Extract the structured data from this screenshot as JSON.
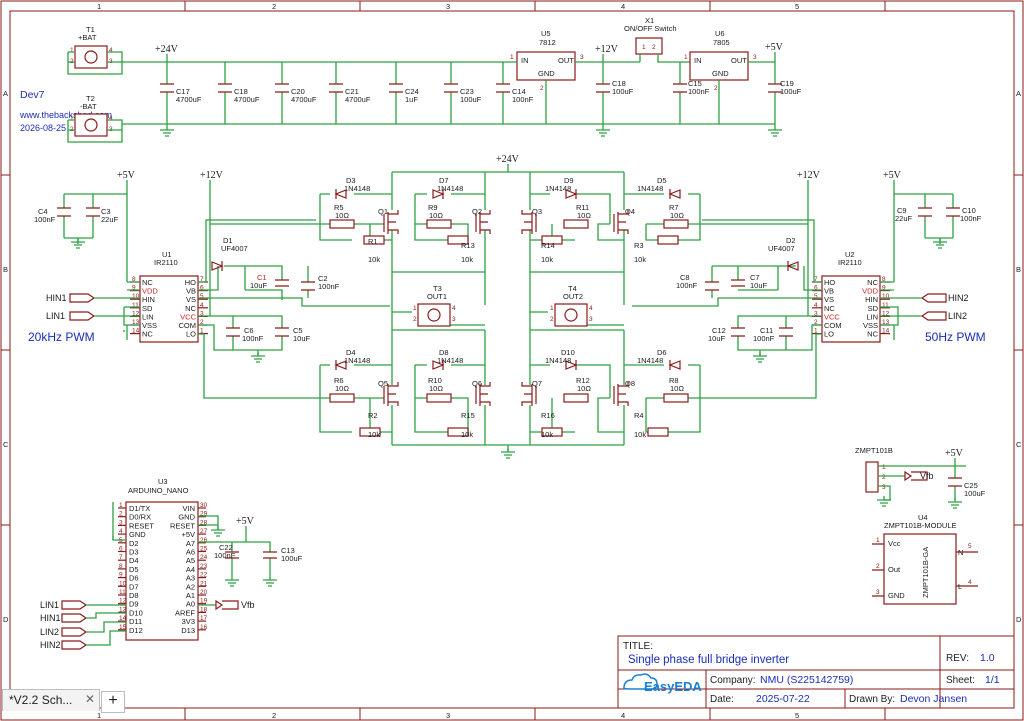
{
  "sheet": {
    "col_labels": [
      "1",
      "2",
      "3",
      "4",
      "5"
    ],
    "row_labels": [
      "A",
      "B",
      "C",
      "D"
    ]
  },
  "notes": {
    "dev": "Dev7",
    "site": "www.thebackshed.com",
    "date": "2026-08-25",
    "pwm_left": "20kHz PWM",
    "pwm_right": "50Hz PWM"
  },
  "rails": {
    "v24": "+24V",
    "v12": "+12V",
    "v5": "+5V"
  },
  "components": {
    "t1_name": "T1",
    "t1_label": "+BAT",
    "t2_name": "T2",
    "t2_label": "-BAT",
    "x1_name": "X1",
    "x1_label": "ON/OFF Switch",
    "u5_name": "U5",
    "u5_part": "7812",
    "u6_name": "U6",
    "u6_part": "7805",
    "pin_in": "IN",
    "pin_out": "OUT",
    "pin_gnd": "GND",
    "c17": "C17",
    "c17v": "4700uF",
    "c18a": "C18",
    "c18av": "4700uF",
    "c20": "C20",
    "c20v": "4700uF",
    "c21": "C21",
    "c21v": "4700uF",
    "c24": "C24",
    "c24v": "1uF",
    "c23": "C23",
    "c23v": "100uF",
    "c14": "C14",
    "c14v": "100nF",
    "c18b": "C18",
    "c18bv": "100uF",
    "c15": "C15",
    "c15v": "100nF",
    "c19": "C19",
    "c19v": "100uF",
    "u1_name": "U1",
    "u1_part": "IR2110",
    "u2_name": "U2",
    "u2_part": "IR2110",
    "u1_pins_left": [
      "NC",
      "VDD",
      "HIN",
      "SD",
      "LIN",
      "VSS",
      "NC"
    ],
    "u1_pins_right": [
      "HO",
      "VB",
      "VS",
      "NC",
      "VCC",
      "COM",
      "LO"
    ],
    "u2_pins_left": [
      "HO",
      "VB",
      "VS",
      "NC",
      "VCC",
      "COM",
      "LO"
    ],
    "u2_pins_right": [
      "NC",
      "VDD",
      "HIN",
      "SD",
      "LIN",
      "VSS",
      "NC"
    ],
    "u1_nums_left": [
      "8",
      "9",
      "10",
      "11",
      "12",
      "13",
      "14"
    ],
    "u1_nums_right": [
      "7",
      "6",
      "5",
      "4",
      "3",
      "2",
      "1"
    ],
    "hin1": "HIN1",
    "lin1": "LIN1",
    "hin2": "HIN2",
    "lin2": "LIN2",
    "c4": "C4",
    "c4v": "100nF",
    "c3": "C3",
    "c3v": "22uF",
    "c9": "C9",
    "c9v": "22uF",
    "c10": "C10",
    "c10v": "100nF",
    "d1": "D1",
    "d1v": "UF4007",
    "d2": "D2",
    "d2v": "UF4007",
    "c1": "C1",
    "c1v": "10uF",
    "c2": "C2",
    "c2v": "100nF",
    "c6": "C6",
    "c6v": "100nF",
    "c5": "C5",
    "c5v": "10uF",
    "c8": "C8",
    "c8v": "100nF",
    "c7": "C7",
    "c7v": "10uF",
    "c12": "C12",
    "c12v": "10uF",
    "c11": "C11",
    "c11v": "100nF",
    "diode_part": "1N4148",
    "d3": "D3",
    "d7": "D7",
    "d9": "D9",
    "d5": "D5",
    "d4": "D4",
    "d8": "D8",
    "d10": "D10",
    "d6": "D6",
    "r10ohm": "10Ω",
    "r10k": "10k",
    "r5": "R5",
    "r9": "R9",
    "r11": "R11",
    "r7": "R7",
    "r6": "R6",
    "r10": "R10",
    "r12": "R12",
    "r8": "R8",
    "r1": "R1",
    "r13": "R13",
    "r14": "R14",
    "r3": "R3",
    "r2": "R2",
    "r15": "R15",
    "r16": "R16",
    "r4": "R4",
    "q1": "Q1",
    "q2": "Q2",
    "q3": "Q3",
    "q4": "Q4",
    "q5": "Q5",
    "q6": "Q6",
    "q7": "Q7",
    "q8": "Q8",
    "t3": "T3",
    "t3v": "OUT1",
    "t4": "T4",
    "t4v": "OUT2",
    "u3_name": "U3",
    "u3_part": "ARDUINO_NANO",
    "nano_left": [
      "D1/TX",
      "D0/RX",
      "RESET",
      "GND",
      "D2",
      "D3",
      "D4",
      "D5",
      "D6",
      "D7",
      "D8",
      "D9",
      "D10",
      "D11",
      "D12"
    ],
    "nano_right": [
      "VIN",
      "GND",
      "RESET",
      "+5V",
      "A7",
      "A6",
      "A5",
      "A4",
      "A3",
      "A2",
      "A1",
      "A0",
      "AREF",
      "3V3",
      "D13"
    ],
    "nano_lnums": [
      "1",
      "2",
      "3",
      "4",
      "5",
      "6",
      "7",
      "8",
      "9",
      "10",
      "11",
      "12",
      "13",
      "14",
      "15"
    ],
    "nano_rnums": [
      "30",
      "29",
      "28",
      "27",
      "26",
      "25",
      "24",
      "23",
      "22",
      "21",
      "20",
      "19",
      "18",
      "17",
      "16"
    ],
    "c22": "C22",
    "c22v": "100nF",
    "c13": "C13",
    "c13v": "100uF",
    "vfb": "Vfb",
    "zmpt_conn": "ZMPT101B",
    "c25": "C25",
    "c25v": "100uF",
    "u4_name": "U4",
    "u4_part": "ZMPT101B-MODULE",
    "u4_pins": [
      "Vcc",
      "Out",
      "GND"
    ],
    "u4_body": "ZMPT101B-GA",
    "u4_n": "N",
    "u4_l": "L"
  },
  "titleblock": {
    "title_label": "TITLE:",
    "title": "Single phase full bridge inverter",
    "rev_label": "REV:",
    "rev": "1.0",
    "logo": "EasyEDA",
    "company_label": "Company:",
    "company": "NMU (S225142759)",
    "sheet_label": "Sheet:",
    "sheet": "1/1",
    "date_label": "Date:",
    "date": "2025-07-22",
    "drawn_label": "Drawn By:",
    "drawn": "Devon Jansen"
  },
  "tabs": {
    "current": "*V2.2 Sch...",
    "add": "+"
  },
  "colors": {
    "wire": "#2ea043",
    "symbol": "#8b1a1a",
    "text": "#1a2db8",
    "border": "#8b1a1a"
  }
}
